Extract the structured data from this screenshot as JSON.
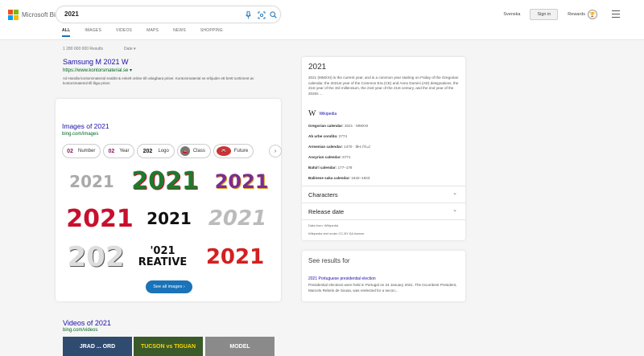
{
  "header": {
    "logo_text": "Microsoft Bing",
    "search_value": "2021",
    "tabs": [
      "ALL",
      "IMAGES",
      "VIDEOS",
      "MAPS",
      "NEWS",
      "SHOPPING"
    ],
    "language": "Svenska",
    "signin": "Sign in",
    "rewards": "Rewards"
  },
  "results": {
    "count": "1 280 000 000 Results",
    "date_filter": "Date",
    "ad": {
      "title": "Samsung M 2021 W",
      "url": "https://www.kontorsmaterial.se",
      "desc": "Ad Handla kontorsmaterial snabbt & enkelt online till oslagbara priser. Kontorsmaterial se erbjuder ett brett sortiment av kontorsmaterial till låga priser."
    },
    "images": {
      "title": "Images of 2021",
      "url": "bing.com/images",
      "chips": [
        {
          "label": "Number",
          "thumb": "02"
        },
        {
          "label": "Year",
          "thumb": "02"
        },
        {
          "label": "Logo",
          "thumb": "202"
        },
        {
          "label": "Class",
          "thumb": "🚗"
        },
        {
          "label": "Future",
          "thumb": "🚘"
        }
      ],
      "tiles": [
        "2021",
        "2021",
        "2021",
        "2021",
        "2021",
        "2021",
        "202",
        "'021 REATIVE",
        "2021"
      ],
      "see_all": "See all images"
    },
    "videos": {
      "title": "Videos of 2021",
      "url": "bing.com/videos",
      "tiles": [
        "JRAD ... ORD",
        "TUCSON vs TIGUAN",
        "MODEL"
      ]
    }
  },
  "knowledge_panel": {
    "title": "2021",
    "description": "2021 (MMXXI) is the current year, and is a common year starting on Friday of the Gregorian calendar, the 2021st year of the Common Era (CE) and Anno Domini (AD) designations, the 21st year of the 3rd millennium, the 21st year of the 21st century, and the 2nd year of the 2020s ...",
    "wiki_label": "Wikipedia",
    "facts": [
      {
        "label": "Gregorian calendar:",
        "value": "2021 · MMXXI"
      },
      {
        "label": "Ab urbe condita:",
        "value": "2774"
      },
      {
        "label": "Armenian calendar:",
        "value": "1470 · ԹՎ ՌՆՀ"
      },
      {
        "label": "Assyrian calendar:",
        "value": "6771"
      },
      {
        "label": "Bahá'í calendar:",
        "value": "177–178"
      },
      {
        "label": "Balinese saka calendar:",
        "value": "1942–1943"
      }
    ],
    "sections": [
      "Characters",
      "Release date"
    ],
    "data_from": "Data from: Wikipedia",
    "license": "Wikipedia text under CC-BY-SA license"
  },
  "see_results": {
    "title": "See results for",
    "link": "2021 Portuguese presidential election",
    "desc": "Presidential elections were held in Portugal on 24 January 2021. The incumbent President, Marcelo Rebelo de Sousa, was reelected for a secon..."
  }
}
